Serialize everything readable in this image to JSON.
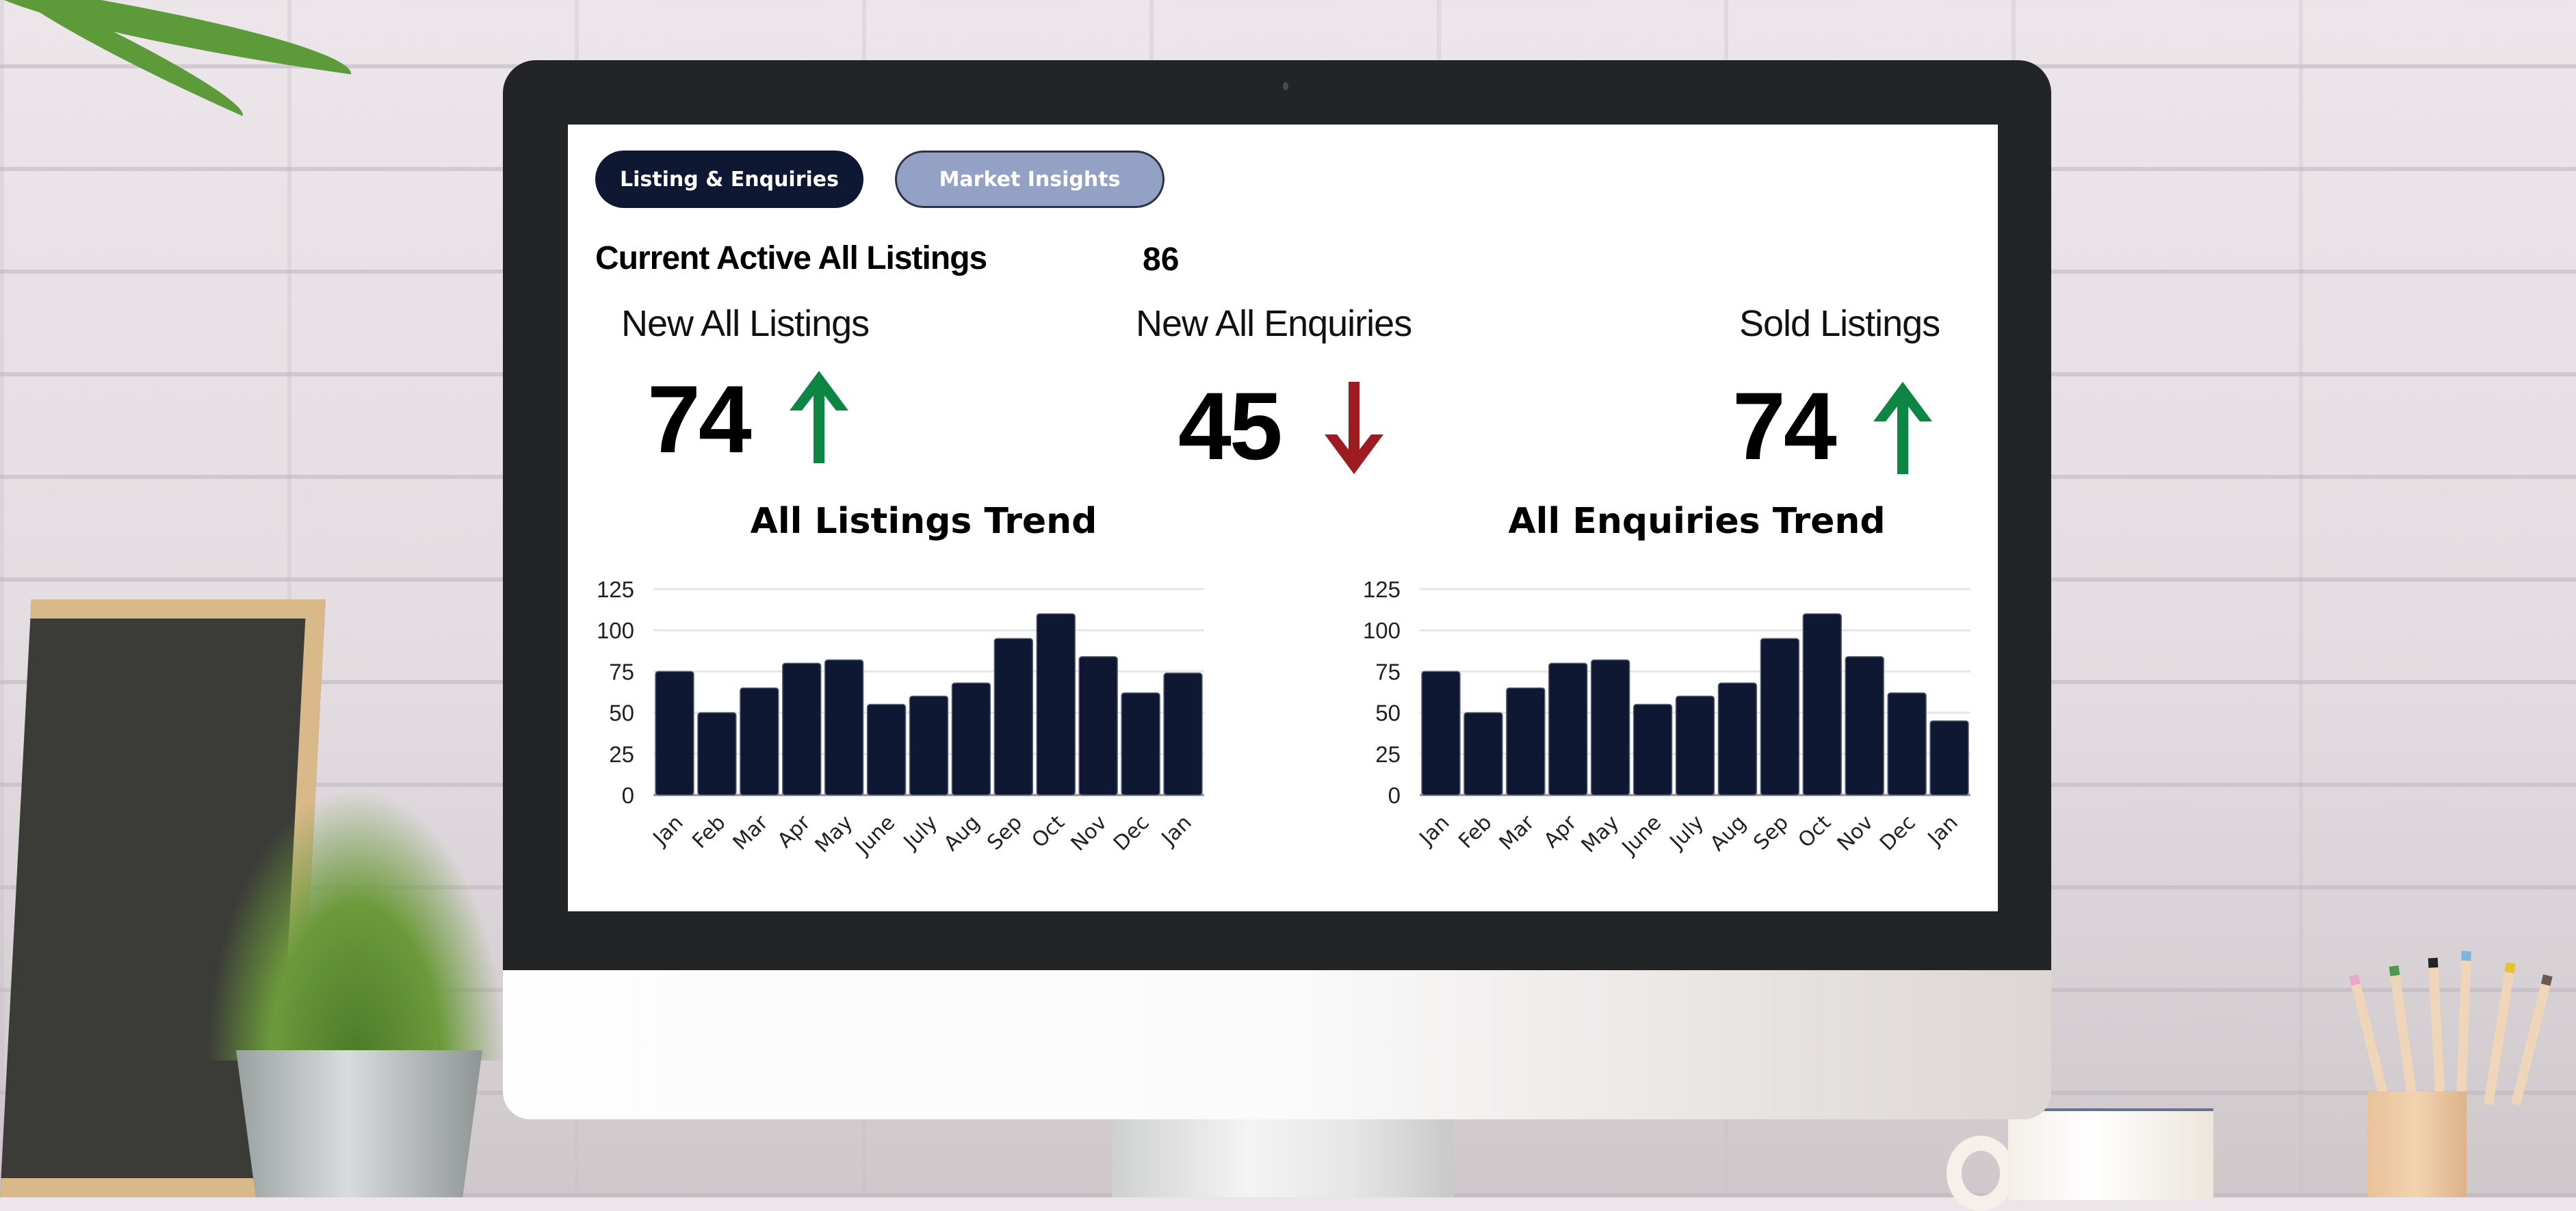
{
  "tabs": [
    {
      "label": "Listing & Enquiries",
      "active": true
    },
    {
      "label": "Market Insights",
      "active": false
    }
  ],
  "summary": {
    "label": "Current Active All Listings",
    "value": "86"
  },
  "kpis": [
    {
      "label": "New All Listings",
      "value": "74",
      "trend": "up",
      "trend_color": "#0e8643"
    },
    {
      "label": "New All Enquiries",
      "value": "45",
      "trend": "down",
      "trend_color": "#9c1c22"
    },
    {
      "label": "Sold Listings",
      "value": "74",
      "trend": "up",
      "trend_color": "#0e8643"
    }
  ],
  "colors": {
    "bar": "#0e1833",
    "tab_active_bg": "#0e1833",
    "tab_inactive_bg": "#93a1c4",
    "grid": "#e6e6e6"
  },
  "chart_data": [
    {
      "type": "bar",
      "title": "All Listings Trend",
      "xlabel": "",
      "ylabel": "",
      "categories": [
        "Jan",
        "Feb",
        "Mar",
        "Apr",
        "May",
        "June",
        "July",
        "Aug",
        "Sep",
        "Oct",
        "Nov",
        "Dec",
        "Jan"
      ],
      "values": [
        75,
        50,
        65,
        80,
        82,
        55,
        60,
        68,
        95,
        110,
        84,
        62,
        74
      ],
      "ylim": [
        0,
        125
      ],
      "yticks": [
        0,
        25,
        50,
        75,
        100,
        125
      ],
      "grid": true,
      "legend": "none"
    },
    {
      "type": "bar",
      "title": "All Enquiries Trend",
      "xlabel": "",
      "ylabel": "",
      "categories": [
        "Jan",
        "Feb",
        "Mar",
        "Apr",
        "May",
        "June",
        "July",
        "Aug",
        "Sep",
        "Oct",
        "Nov",
        "Dec",
        "Jan"
      ],
      "values": [
        75,
        50,
        65,
        80,
        82,
        55,
        60,
        68,
        95,
        110,
        84,
        62,
        45
      ],
      "ylim": [
        0,
        125
      ],
      "yticks": [
        0,
        25,
        50,
        75,
        100,
        125
      ],
      "grid": true,
      "legend": "none"
    }
  ]
}
